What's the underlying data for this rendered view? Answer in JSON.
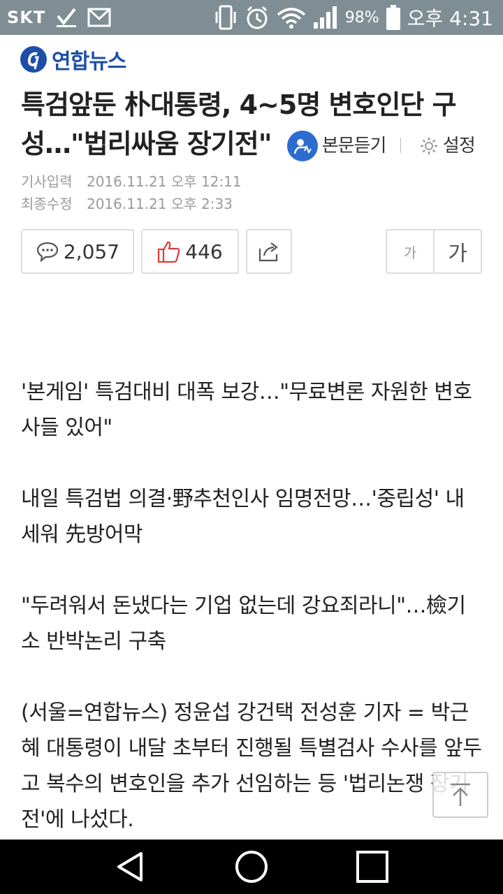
{
  "statusbar": {
    "carrier": "SKT",
    "battery": "98%",
    "time": "오후 4:31",
    "battery_level": 0.98
  },
  "header": {
    "logo_text": "연합뉴스"
  },
  "article": {
    "title": "특검앞둔 朴대통령, 4~5명 변호인단 구성…\"법리싸움 장기전\"",
    "listen_label": "본문듣기",
    "settings_label": "설정",
    "meta": {
      "input_label": "기사입력",
      "input_time": "2016.11.21 오후 12:11",
      "modified_label": "최종수정",
      "modified_time": "2016.11.21 오후 2:33"
    },
    "comment_count": "2,057",
    "like_count": "446",
    "font_small": "가",
    "font_large": "가",
    "paragraphs": [
      "'본게임' 특검대비 대폭 보강…\"무료변론 자원한 변호사들 있어\"",
      "내일 특검법 의결·野추천인사 임명전망…'중립성' 내세워 先방어막",
      "\"두려워서 돈냈다는 기업 없는데 강요죄라니\"…檢기소 반박논리 구축",
      "(서울=연합뉴스) 정윤섭 강건택 전성훈 기자 = 박근혜 대통령이 내달 초부터 진행될 특별검사 수사를 앞두고 복수의 변호인을 추가 선임하는 등 '법리논쟁 장기전'에 나섰다."
    ]
  },
  "colors": {
    "statusbar": "#7e8e94",
    "brand_blue": "#1d4ea8",
    "listen_blue": "#2d6ccf",
    "like_red": "#e03a3a"
  },
  "icons": {
    "check": "check-icon",
    "mail": "mail-icon",
    "vibrate": "vibrate-icon",
    "alarm": "alarm-icon",
    "wifi": "wifi-icon",
    "signal": "signal-icon",
    "battery": "battery-icon",
    "comment": "comment-icon",
    "like": "thumbs-up-icon",
    "share": "share-icon",
    "top": "scroll-top-icon",
    "back": "back-icon",
    "home": "home-icon",
    "recents": "recents-icon"
  }
}
